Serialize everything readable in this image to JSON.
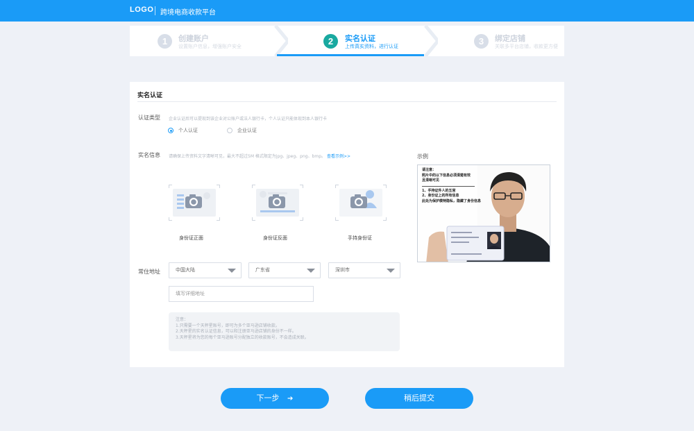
{
  "header": {
    "logo": "LOGO",
    "title": "跨境电商收款平台"
  },
  "steps": [
    {
      "num": "1",
      "title": "创建账户",
      "sub": "设置账户信息，增强账户安全",
      "state": "done"
    },
    {
      "num": "2",
      "title": "实名认证",
      "sub": "上传真实资料，进行认证",
      "state": "active"
    },
    {
      "num": "3",
      "title": "绑定店铺",
      "sub": "关联多平台店铺，收款更方便",
      "state": "todo"
    }
  ],
  "panel": {
    "title": "实名认证",
    "auth_type": {
      "label": "认证类型",
      "hint": "企业认证后可以提现到该企业对公账户或法人银行卡，个人认证只能体现到本人银行卡",
      "options": [
        {
          "label": "个人认证",
          "selected": true
        },
        {
          "label": "企业认证",
          "selected": false
        }
      ]
    },
    "realname": {
      "label": "实名信息",
      "hint": "请确保上传资料文字清晰可见，最大不超过5M 格式限定为jpg、jpeg、png、bmp。",
      "hint_link": "查看示例>>",
      "uploads": [
        {
          "caption": "身份证正面",
          "icon": "id-card-front-icon"
        },
        {
          "caption": "身份证反面",
          "icon": "id-card-back-icon"
        },
        {
          "caption": "手持身份证",
          "icon": "hand-held-id-icon"
        }
      ]
    },
    "address": {
      "label": "常住地址",
      "country": "中国大陆",
      "province": "广东省",
      "city": "深圳市",
      "detail_placeholder": "填写详细地址"
    },
    "notice": {
      "title": "注意：",
      "lines": [
        "1.只需要一个天秤星账号，即可为多个亚马逊店铺收款。",
        "2.天秤星的实名认证信息，可以和注册亚马逊店铺的身份不一样。",
        "3.天秤星将为您的每个亚马逊账号分配独立的收款账号，不会造成关联。"
      ]
    },
    "example": {
      "label": "示例",
      "note_lines": [
        "请注意：",
        "照片中的以下信息必须清楚有效",
        "且清晰可见",
        "1、手持证件人的五官",
        "2、身份证上的所有信息",
        "此处为保护模特隐私，隐藏了身份信息"
      ]
    }
  },
  "buttons": {
    "next": "下一步",
    "next_arrow": "➔",
    "later": "稍后提交"
  },
  "colors": {
    "primary": "#1a9bf7",
    "step_active_circle": "#19a9a0",
    "background": "#eef1f7"
  }
}
